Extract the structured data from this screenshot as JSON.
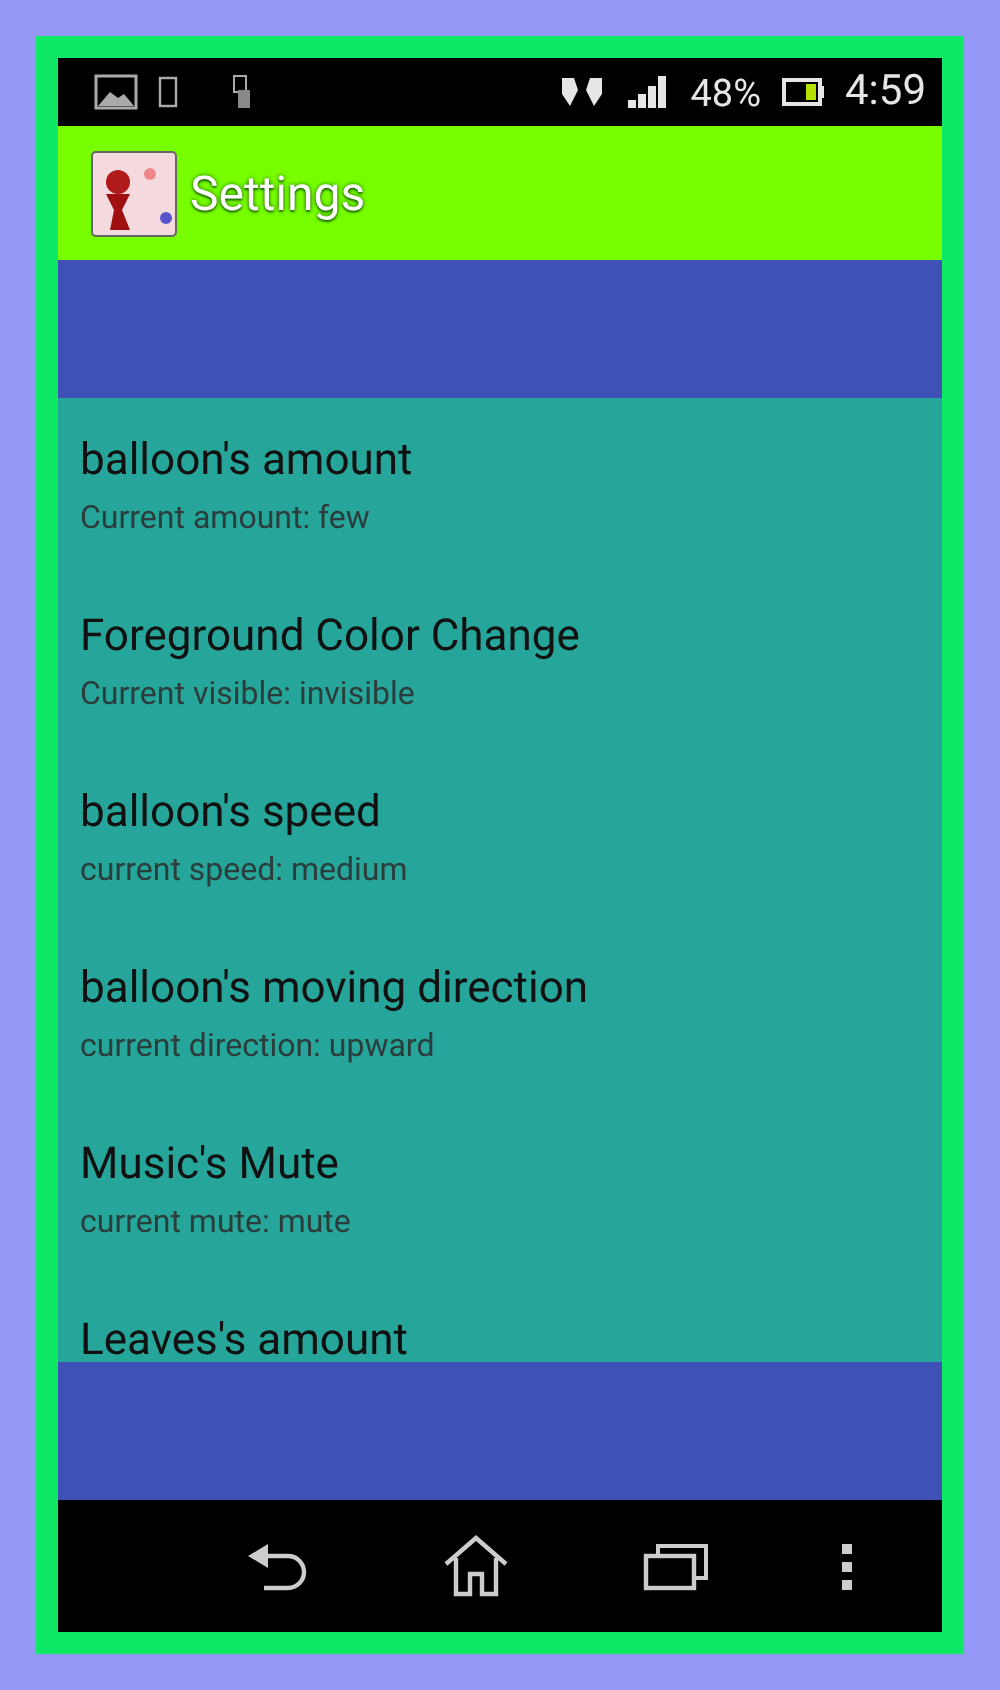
{
  "status_bar": {
    "battery_text": "48%",
    "time": "4:59"
  },
  "action_bar": {
    "title": "Settings"
  },
  "preferences": [
    {
      "title": "balloon's amount",
      "summary": "Current amount: few"
    },
    {
      "title": "Foreground Color Change",
      "summary": "Current visible: invisible"
    },
    {
      "title": "balloon's speed",
      "summary": "current speed: medium"
    },
    {
      "title": "balloon's moving direction",
      "summary": "current direction: upward"
    },
    {
      "title": "Music's Mute",
      "summary": "current mute: mute"
    },
    {
      "title": "Leaves's amount"
    }
  ]
}
